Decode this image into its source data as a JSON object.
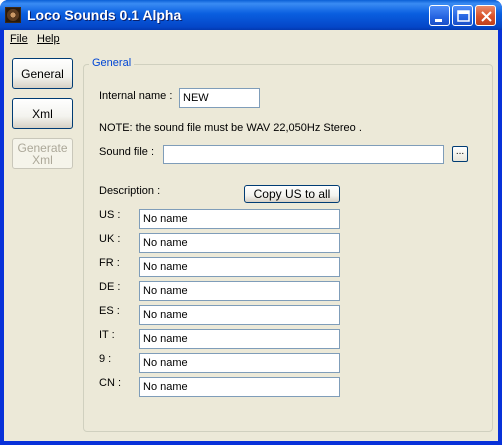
{
  "window": {
    "title": "Loco Sounds 0.1 Alpha",
    "controls": {
      "minimize": "minimize-icon",
      "maximize": "maximize-icon",
      "close": "close-icon"
    }
  },
  "menu": {
    "file": "File",
    "help": "Help"
  },
  "side_buttons": {
    "general": "General",
    "xml": "Xml",
    "generate_xml": "Generate Xml"
  },
  "group": {
    "title": "General",
    "internal_name_label": "Internal name :",
    "internal_name_value": "NEW",
    "note": "NOTE: the sound file must be WAV 22,050Hz Stereo .",
    "sound_file_label": "Sound file :",
    "sound_file_value": "",
    "browse_label": "...",
    "description_label": "Description :",
    "copy_button": "Copy US to all",
    "descriptions": [
      {
        "code": "US :",
        "value": "No name"
      },
      {
        "code": "UK :",
        "value": "No name"
      },
      {
        "code": "FR :",
        "value": "No name"
      },
      {
        "code": "DE :",
        "value": "No name"
      },
      {
        "code": "ES :",
        "value": "No name"
      },
      {
        "code": "IT :",
        "value": "No name"
      },
      {
        "code": "9 :",
        "value": "No name"
      },
      {
        "code": "CN :",
        "value": "No name"
      }
    ]
  },
  "colors": {
    "title_bar": "#0a5fe0",
    "client_bg": "#ece9d8",
    "group_title": "#0046d5"
  }
}
